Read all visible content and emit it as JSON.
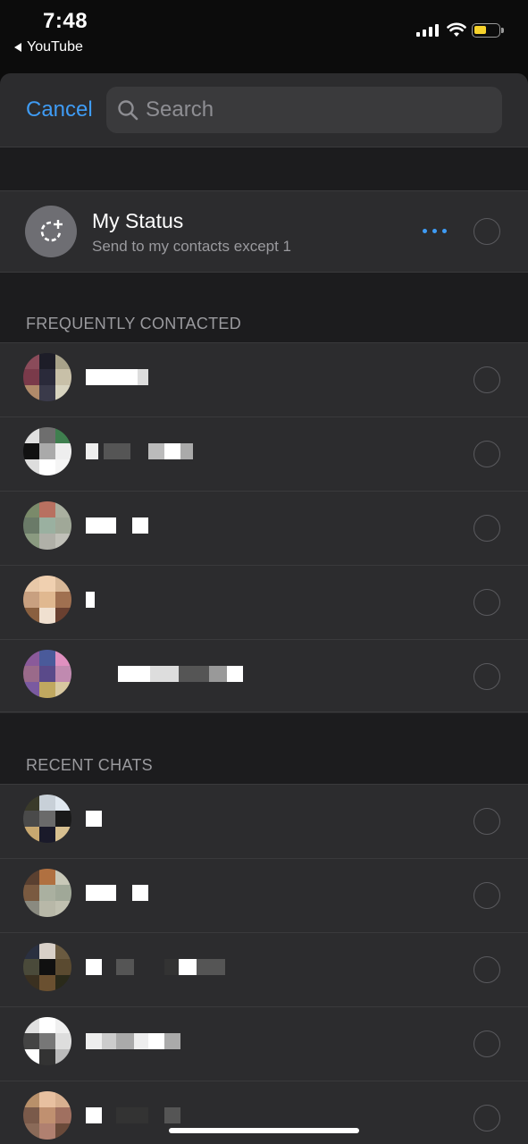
{
  "status_bar": {
    "time": "7:48",
    "back_app": "YouTube",
    "battery_color": "#f6d22b"
  },
  "header": {
    "cancel_label": "Cancel",
    "search_placeholder": "Search"
  },
  "my_status": {
    "title": "My Status",
    "subtitle": "Send to my contacts except 1",
    "icon": "status-add-icon",
    "more_icon": "ellipsis-icon"
  },
  "sections": {
    "frequent": "FREQUENTLY CONTACTED",
    "recent": "RECENT CHATS"
  },
  "frequent_contacts": [
    {
      "name": "",
      "name_note": "redacted"
    },
    {
      "name": "",
      "name_note": "redacted"
    },
    {
      "name": "",
      "name_note": "redacted"
    },
    {
      "name": "",
      "name_note": "redacted"
    },
    {
      "name": "",
      "name_note": "redacted"
    }
  ],
  "recent_chats": [
    {
      "name": "",
      "name_note": "redacted"
    },
    {
      "name": "",
      "name_note": "redacted"
    },
    {
      "name": "",
      "name_note": "redacted"
    },
    {
      "name": "",
      "name_note": "redacted"
    },
    {
      "name": "",
      "name_note": "redacted"
    }
  ],
  "colors": {
    "accent": "#3f9cf5",
    "row_bg": "#2c2c2e",
    "sheet_bg": "#1c1c1e"
  }
}
